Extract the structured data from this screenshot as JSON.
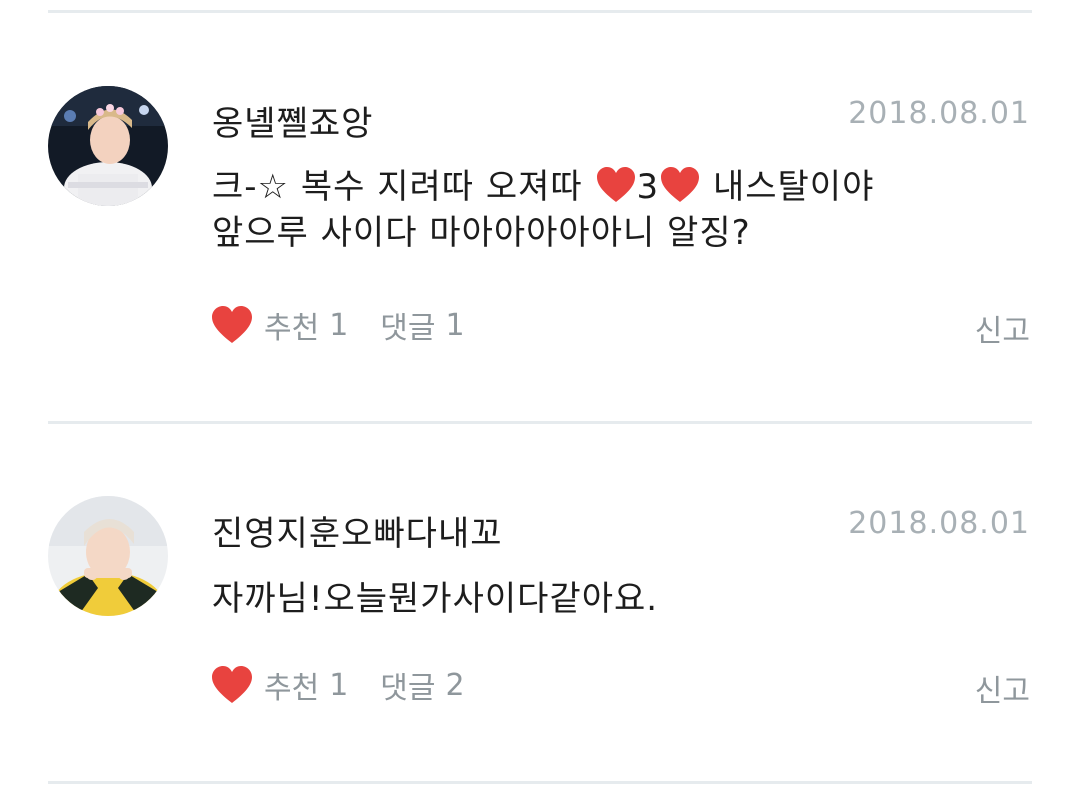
{
  "comments": [
    {
      "author": "옹녤쪨죠앙",
      "date": "2018.08.01",
      "body_line1_a": "크-☆ 복수 지려따 오져따 ",
      "body_line1_b": "3",
      "body_line1_c": " 내스탈이야",
      "body_line2": "앞으루 사이다 마아아아아아니 알징?",
      "likes_label": "추천",
      "likes_count": "1",
      "replies_label": "댓글",
      "replies_count": "1",
      "report_label": "신고"
    },
    {
      "author": "진영지훈오빠다내꼬",
      "date": "2018.08.01",
      "body_line1": "자까님!오늘뭔가사이다같아요.",
      "likes_label": "추천",
      "likes_count": "1",
      "replies_label": "댓글",
      "replies_count": "2",
      "report_label": "신고"
    }
  ],
  "colors": {
    "heart": "#e8433f",
    "muted_text": "#8f979c",
    "date_text": "#a8b0b5",
    "divider": "#e6ebee"
  },
  "icons": {
    "like": "heart-icon",
    "inline_emoji": "red-heart-icon"
  }
}
